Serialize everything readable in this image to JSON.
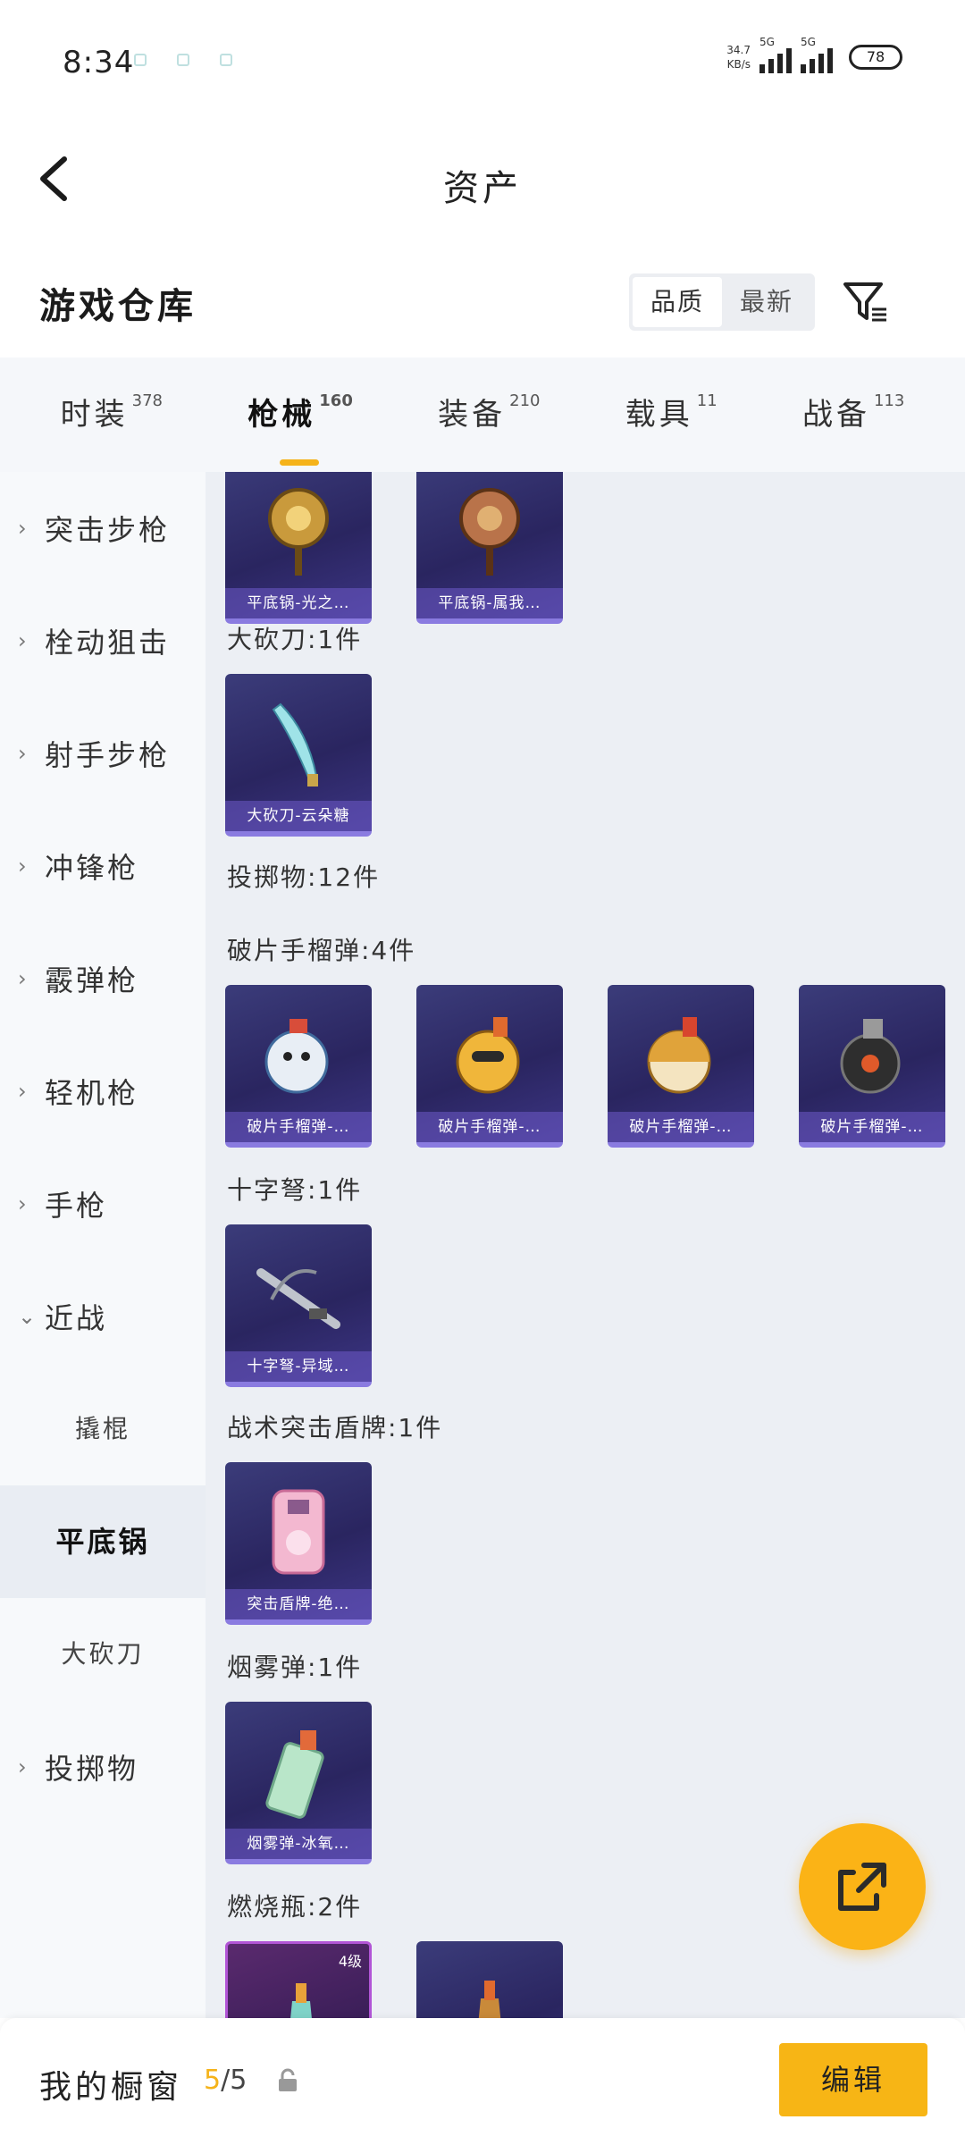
{
  "status_bar": {
    "time": "8:34",
    "net_speed_value": "34.7",
    "net_speed_unit": "KB/s",
    "net_type_1": "5G",
    "net_type_2": "5G",
    "battery": "78"
  },
  "header": {
    "title": "资产"
  },
  "section": {
    "title": "游戏仓库",
    "sort_options": [
      "品质",
      "最新"
    ],
    "active_sort": "品质"
  },
  "tabs": [
    {
      "label": "时装",
      "count": "378"
    },
    {
      "label": "枪械",
      "count": "160"
    },
    {
      "label": "装备",
      "count": "210"
    },
    {
      "label": "载具",
      "count": "11"
    },
    {
      "label": "战备",
      "count": "113"
    }
  ],
  "active_tab": "枪械",
  "sidebar": {
    "categories": [
      {
        "label": "突击步枪"
      },
      {
        "label": "栓动狙击"
      },
      {
        "label": "射手步枪"
      },
      {
        "label": "冲锋枪"
      },
      {
        "label": "霰弹枪"
      },
      {
        "label": "轻机枪"
      },
      {
        "label": "手枪"
      },
      {
        "label": "近战"
      }
    ],
    "sub_items": [
      {
        "label": "撬棍"
      },
      {
        "label": "平底锅"
      },
      {
        "label": "大砍刀"
      }
    ],
    "last_category": {
      "label": "投掷物"
    },
    "active_sub": "平底锅"
  },
  "content": {
    "top_cards": [
      {
        "caption": "平底锅-光之…"
      },
      {
        "caption": "平底锅-属我…"
      }
    ],
    "groups": [
      {
        "label": "大砍刀:1件",
        "cards": [
          {
            "caption": "大砍刀-云朵糖"
          }
        ]
      },
      {
        "label": "投掷物:12件",
        "cards": []
      },
      {
        "label": "破片手榴弹:4件",
        "cards": [
          {
            "caption": "破片手榴弹-…"
          },
          {
            "caption": "破片手榴弹-…"
          },
          {
            "caption": "破片手榴弹-…"
          },
          {
            "caption": "破片手榴弹-…"
          }
        ]
      },
      {
        "label": "十字弩:1件",
        "cards": [
          {
            "caption": "十字弩-异域…"
          }
        ]
      },
      {
        "label": "战术突击盾牌:1件",
        "cards": [
          {
            "caption": "突击盾牌-绝…"
          }
        ]
      },
      {
        "label": "烟雾弹:1件",
        "cards": [
          {
            "caption": "烟雾弹-冰氧…"
          }
        ]
      },
      {
        "label": "燃烧瓶:2件",
        "cards": [
          {
            "caption": "",
            "badge": "4级"
          },
          {
            "caption": ""
          }
        ]
      }
    ]
  },
  "bottom_bar": {
    "label": "我的橱窗",
    "count_current": "5",
    "count_total": "/5",
    "edit_label": "编辑"
  },
  "colors": {
    "accent": "#f7b515",
    "card_bg": "#2a2560",
    "card_border": "#8a7be0"
  }
}
